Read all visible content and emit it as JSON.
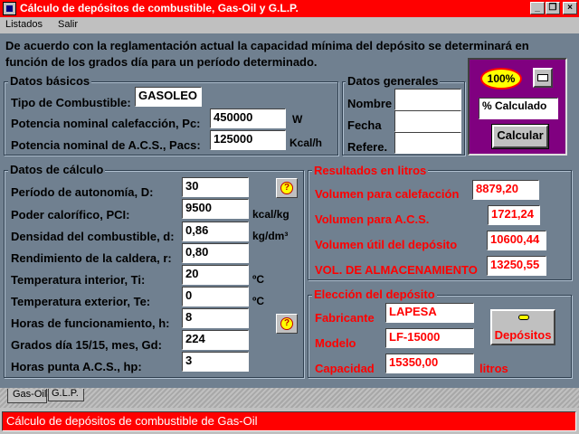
{
  "window": {
    "title": "Cálculo de depósitos de combustible, Gas-Oil y G.L.P."
  },
  "menu": {
    "items": [
      "Listados",
      "Salir"
    ]
  },
  "intro": "De acuerdo con la reglamentación actual la capacidad mínima del depósito se determinará en función de los grados día para un período determinado.",
  "datos_basicos": {
    "title": "Datos básicos",
    "tipo_label": "Tipo de Combustible:",
    "tipo_value": "GASOLEO",
    "potencia_cal_label": "Potencia nominal calefacción, Pc:",
    "potencia_cal_value": "450000",
    "potencia_cal_unit": "W",
    "potencia_acs_label": "Potencia nominal de A.C.S., Pacs:",
    "potencia_acs_value": "125000",
    "potencia_acs_unit": "Kcal/h"
  },
  "datos_generales": {
    "title": "Datos generales",
    "nombre_label": "Nombre",
    "nombre_value": "",
    "fecha_label": "Fecha",
    "fecha_value": "",
    "refere_label": "Refere.",
    "refere_value": ""
  },
  "tools": {
    "zoom": "100%",
    "modo_value": "% Calculado",
    "calcular_label": "Calcular"
  },
  "datos_calculo": {
    "title": "Datos de cálculo",
    "rows": [
      {
        "label": "Período de autonomía, D:",
        "value": "30",
        "unit": ""
      },
      {
        "label": "Poder calorífico, PCI:",
        "value": "9500",
        "unit": "kcal/kg"
      },
      {
        "label": "Densidad del combustible, d:",
        "value": "0,86",
        "unit": "kg/dm³"
      },
      {
        "label": "Rendimiento de la caldera, r:",
        "value": "0,80",
        "unit": ""
      },
      {
        "label": "Temperatura interior, Ti:",
        "value": "20",
        "unit": "ºC"
      },
      {
        "label": "Temperatura exterior, Te:",
        "value": "0",
        "unit": "ºC"
      },
      {
        "label": "Horas de funcionamiento, h:",
        "value": "8",
        "unit": ""
      },
      {
        "label": "Grados día 15/15, mes, Gd:",
        "value": "224",
        "unit": ""
      },
      {
        "label": "Horas punta A.C.S., hp:",
        "value": "3",
        "unit": ""
      }
    ]
  },
  "resultados": {
    "title": "Resultados en litros",
    "rows": [
      {
        "label": "Volumen para calefacción",
        "value": "8879,20"
      },
      {
        "label": "Volumen para A.C.S.",
        "value": "1721,24"
      },
      {
        "label": "Volumen útil del depósito",
        "value": "10600,44"
      },
      {
        "label": "VOL. DE ALMACENAMIENTO",
        "value": "13250,55"
      }
    ]
  },
  "eleccion": {
    "title": "Elección del depósito",
    "fabricante_label": "Fabricante",
    "fabricante_value": "LAPESA",
    "modelo_label": "Modelo",
    "modelo_value": "LF-15000",
    "capacidad_label": "Capacidad",
    "capacidad_value": "15350,00",
    "capacidad_unit": "litros",
    "depositos_label": "Depósitos"
  },
  "tabs": [
    "Gas-Oil",
    "G.L.P."
  ],
  "status": "Cálculo de depósitos de combustible de Gas-Oil",
  "colors": {
    "title_bar": "#ff0000",
    "content_bg": "#708090",
    "tools_panel": "#800080",
    "result_text": "#ff0000"
  }
}
